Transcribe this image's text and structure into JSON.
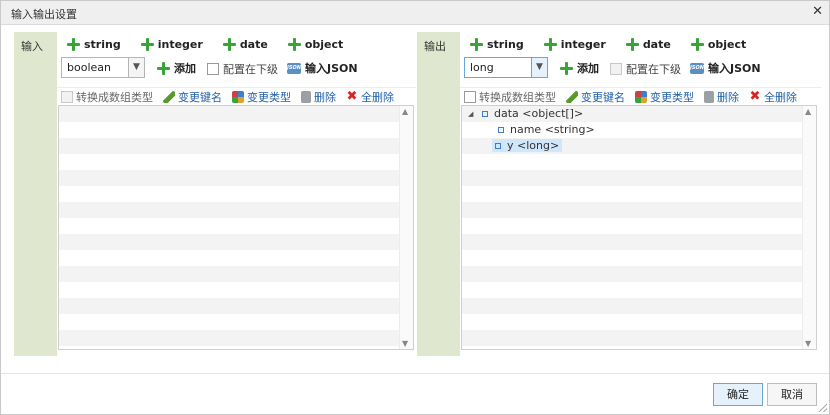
{
  "dialog": {
    "title": "输入输出设置",
    "close_icon": "close-icon"
  },
  "input": {
    "label": "输入",
    "type_buttons": [
      "string",
      "integer",
      "date",
      "object"
    ],
    "type_select": {
      "value": "boolean"
    },
    "add_label": "添加",
    "config_lower_label": "配置在下级",
    "import_json_label": "输入JSON",
    "toolbar": {
      "convert_array_label": "转换成数组类型",
      "rename_label": "变更键名",
      "change_type_label": "变更类型",
      "delete_label": "删除",
      "delete_all_label": "全删除"
    }
  },
  "output": {
    "label": "输出",
    "type_buttons": [
      "string",
      "integer",
      "date",
      "object"
    ],
    "type_select": {
      "value": "long"
    },
    "add_label": "添加",
    "config_lower_label": "配置在下级",
    "import_json_label": "输入JSON",
    "toolbar": {
      "convert_array_label": "转换成数组类型",
      "rename_label": "变更键名",
      "change_type_label": "变更类型",
      "delete_label": "删除",
      "delete_all_label": "全删除"
    },
    "tree": [
      {
        "label": "data <object[]>"
      },
      {
        "label": "name <string>"
      },
      {
        "label": "y <long>"
      }
    ]
  },
  "footer": {
    "ok_label": "确定",
    "cancel_label": "取消"
  }
}
